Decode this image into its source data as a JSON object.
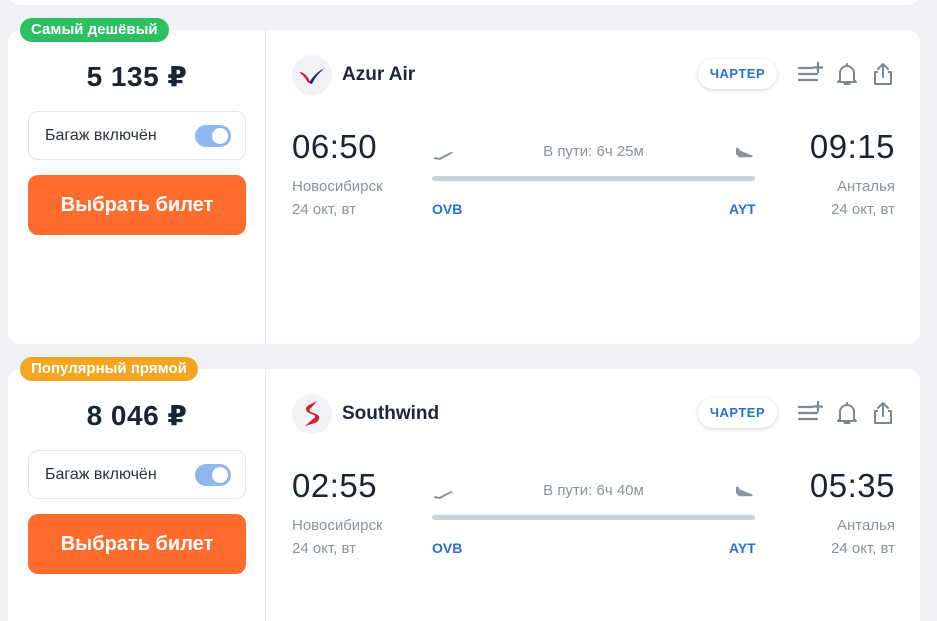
{
  "colors": {
    "accent": "#ff6d2e",
    "link_blue": "#2d6fd0",
    "badge_cheapest": "#2cc062",
    "badge_popular": "#f2a622",
    "toggle_on": "#8fb6ef"
  },
  "tickets": [
    {
      "badge": "Самый дешёвый",
      "price": "5 135 ₽",
      "baggage_label": "Багаж включён",
      "baggage_included": true,
      "buy_label": "Выбрать билет",
      "airline": "Azur Air",
      "airline_logo_icon": "azur-air-logo-icon",
      "charter_label": "ЧАРТЕР",
      "departure": {
        "time": "06:50",
        "city": "Новосибирск",
        "date": "24 окт, вт",
        "iata": "OVB"
      },
      "arrival": {
        "time": "09:15",
        "city": "Анталья",
        "date": "24 окт, вт",
        "iata": "AYT"
      },
      "duration": "В пути: 6ч 25м"
    },
    {
      "badge": "Популярный прямой",
      "price": "8 046 ₽",
      "baggage_label": "Багаж включён",
      "baggage_included": true,
      "buy_label": "Выбрать билет",
      "airline": "Southwind",
      "airline_logo_icon": "southwind-logo-icon",
      "charter_label": "ЧАРТЕР",
      "departure": {
        "time": "02:55",
        "city": "Новосибирск",
        "date": "24 окт, вт",
        "iata": "OVB"
      },
      "arrival": {
        "time": "05:35",
        "city": "Анталья",
        "date": "24 окт, вт",
        "iata": "AYT"
      },
      "duration": "В пути: 6ч 40м"
    }
  ]
}
